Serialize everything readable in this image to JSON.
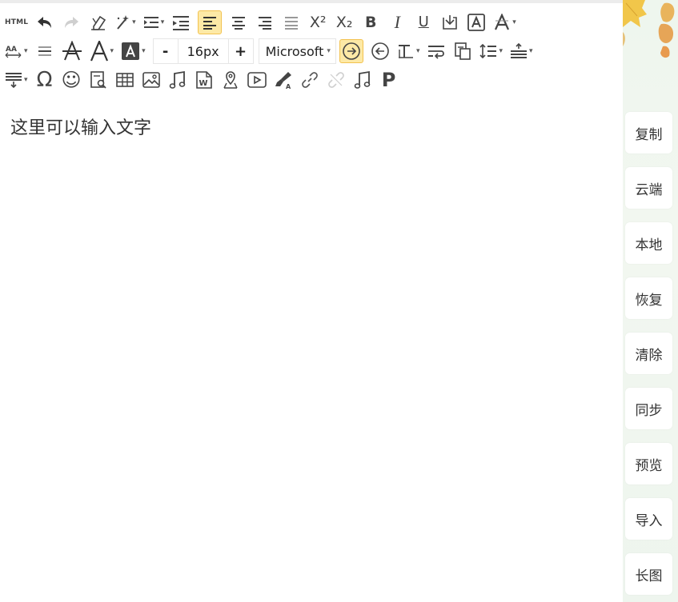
{
  "toolbar": {
    "html_label": "HTML",
    "font_size_minus": "-",
    "font_size_value": "16px",
    "font_size_plus": "+",
    "font_family": "Microsoft",
    "superscript_label": "X²",
    "subscript_label": "X₂",
    "bold_label": "B",
    "italic_label": "I",
    "underline_label": "U",
    "paragraph_label": "P",
    "omega_label": "Ω",
    "smiley_label": "☺",
    "active_color": "#fde9a6"
  },
  "editor": {
    "content_text": "这里可以输入文字"
  },
  "sidebar": {
    "items": [
      "复制",
      "云端",
      "本地",
      "恢复",
      "清除",
      "同步",
      "预览",
      "导入",
      "长图"
    ]
  }
}
